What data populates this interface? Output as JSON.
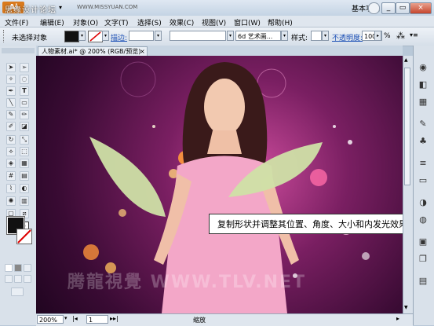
{
  "title_bar": {
    "app_logo": "Ai",
    "site_watermark": "思缘设计论坛",
    "site_url": "WWW.MISSYUAN.COM",
    "workspace": "基本功能",
    "workspace_arrow": "▾",
    "search_icon": "search-icon",
    "min_label": "_",
    "restore_label": "▭",
    "close_label": "×"
  },
  "menu": {
    "items": [
      "文件(F)",
      "编辑(E)",
      "对象(O)",
      "文字(T)",
      "选择(S)",
      "效果(C)",
      "视图(V)",
      "窗口(W)",
      "帮助(H)"
    ]
  },
  "control_bar": {
    "selection_label": "未选择对象",
    "stroke_label": "描边:",
    "brush_label": "6d 艺术画...",
    "style_label": "样式:",
    "opacity_label": "不透明度:",
    "opacity_value": "100",
    "opacity_unit": "%"
  },
  "document": {
    "tab_title": "人物素材.ai* @ 200% (RGB/预览)",
    "close_label": "×"
  },
  "canvas": {
    "watermark": "腾龍視覺 WWW.TLV.NET",
    "caption": "复制形状并调整其位置、角度、大小和内发光效果"
  },
  "status_bar": {
    "zoom": "200%",
    "page": "1",
    "status": "缩放"
  },
  "colors": {
    "fill": "#111111",
    "stroke": "#ffffff",
    "leaf": "#cfe0a6",
    "background": "#5a1450"
  }
}
